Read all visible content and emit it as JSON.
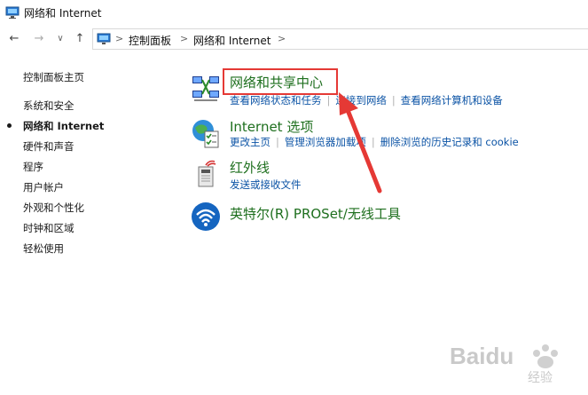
{
  "window": {
    "title": "网络和 Internet"
  },
  "nav": {
    "back_glyph": "←",
    "forward_glyph": "→",
    "dropdown_glyph": "∨",
    "up_glyph": "↑"
  },
  "breadcrumb": {
    "items": [
      "控制面板",
      "网络和 Internet"
    ],
    "separator": ">"
  },
  "sidebar": {
    "items": [
      {
        "label": "控制面板主页",
        "active": false
      },
      {
        "label": "系统和安全",
        "active": false
      },
      {
        "label": "网络和 Internet",
        "active": true
      },
      {
        "label": "硬件和声音",
        "active": false
      },
      {
        "label": "程序",
        "active": false
      },
      {
        "label": "用户帐户",
        "active": false
      },
      {
        "label": "外观和个性化",
        "active": false
      },
      {
        "label": "时钟和区域",
        "active": false
      },
      {
        "label": "轻松使用",
        "active": false
      }
    ]
  },
  "categories": [
    {
      "title": "网络和共享中心",
      "icon": "network-sharing-icon",
      "links": [
        "查看网络状态和任务",
        "连接到网络",
        "查看网络计算机和设备"
      ]
    },
    {
      "title": "Internet 选项",
      "icon": "internet-options-icon",
      "links": [
        "更改主页",
        "管理浏览器加载项",
        "删除浏览的历史记录和 cookie"
      ]
    },
    {
      "title": "红外线",
      "icon": "infrared-icon",
      "links": [
        "发送或接收文件"
      ]
    },
    {
      "title": "英特尔(R) PROSet/无线工具",
      "icon": "wireless-icon",
      "links": []
    }
  ],
  "annotation": {
    "highlight_color": "#e53935"
  },
  "watermark": {
    "brand": "Baidu",
    "sub": "经验"
  },
  "colors": {
    "category_title": "#1e6f1e",
    "link": "#0b53a5"
  }
}
